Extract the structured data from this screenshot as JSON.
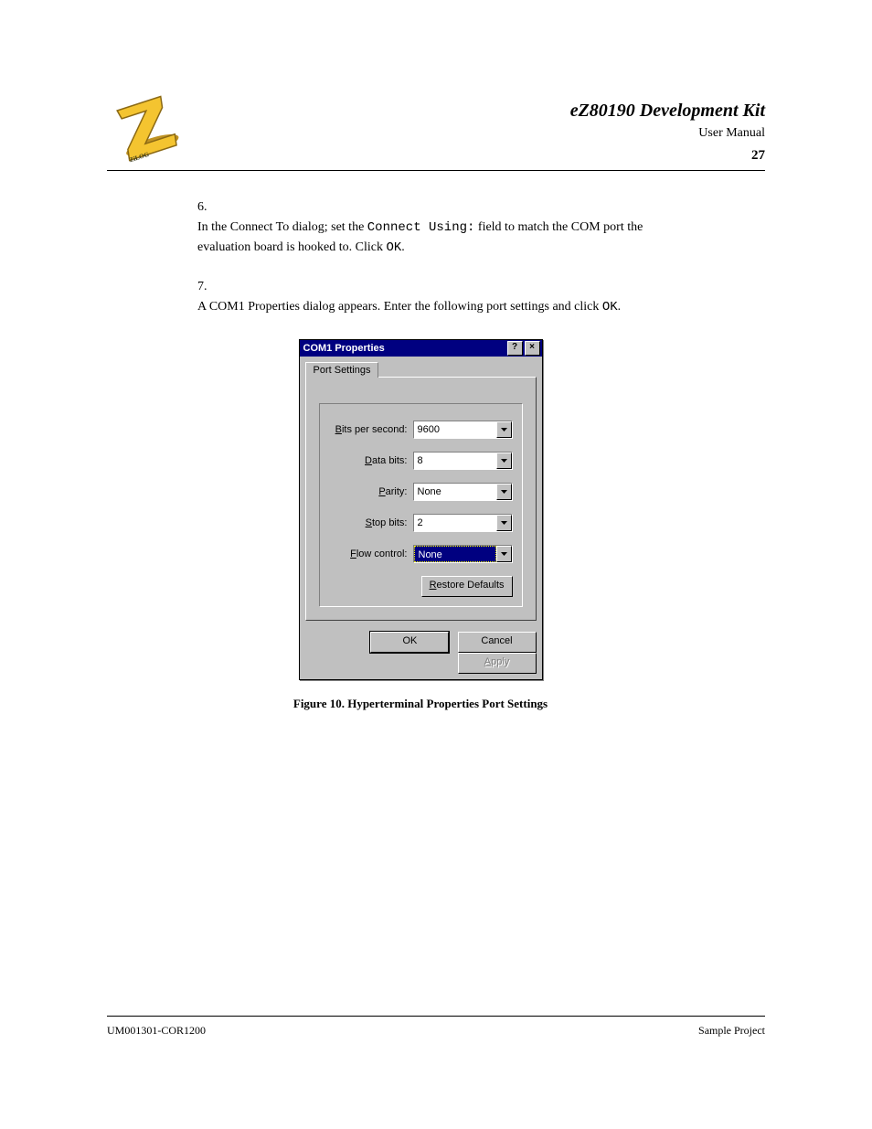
{
  "header": {
    "title_line1": "eZ80190 Development Kit",
    "title_line2": "User Manual",
    "page_num": "27"
  },
  "steps": [
    {
      "n": "6.",
      "text": "In the Connect To dialog; set the Connect Using: field to match the COM port the evaluation board is hooked to. Click OK."
    },
    {
      "n": "7.",
      "text": "A COM1 Properties dialog appears. Enter the following port settings and click OK."
    }
  ],
  "dialog": {
    "title": "COM1 Properties",
    "help_glyph": "?",
    "close_glyph": "×",
    "tab_label": "Port Settings",
    "fields": [
      {
        "label_pre": "",
        "u": "B",
        "label_post": "its per second:",
        "value": "9600",
        "selected": false
      },
      {
        "label_pre": "",
        "u": "D",
        "label_post": "ata bits:",
        "value": "8",
        "selected": false
      },
      {
        "label_pre": "",
        "u": "P",
        "label_post": "arity:",
        "value": "None",
        "selected": false
      },
      {
        "label_pre": "",
        "u": "S",
        "label_post": "top bits:",
        "value": "2",
        "selected": false
      },
      {
        "label_pre": "",
        "u": "F",
        "label_post": "low control:",
        "value": "None",
        "selected": true
      }
    ],
    "restore_u": "R",
    "restore_label": "estore Defaults",
    "ok": "OK",
    "cancel": "Cancel",
    "apply_u": "A",
    "apply_label": "pply"
  },
  "figure_caption": "Figure 10. Hyperterminal Properties Port Settings",
  "footer": {
    "left": "UM001301-COR1200",
    "right": "Sample Project"
  }
}
